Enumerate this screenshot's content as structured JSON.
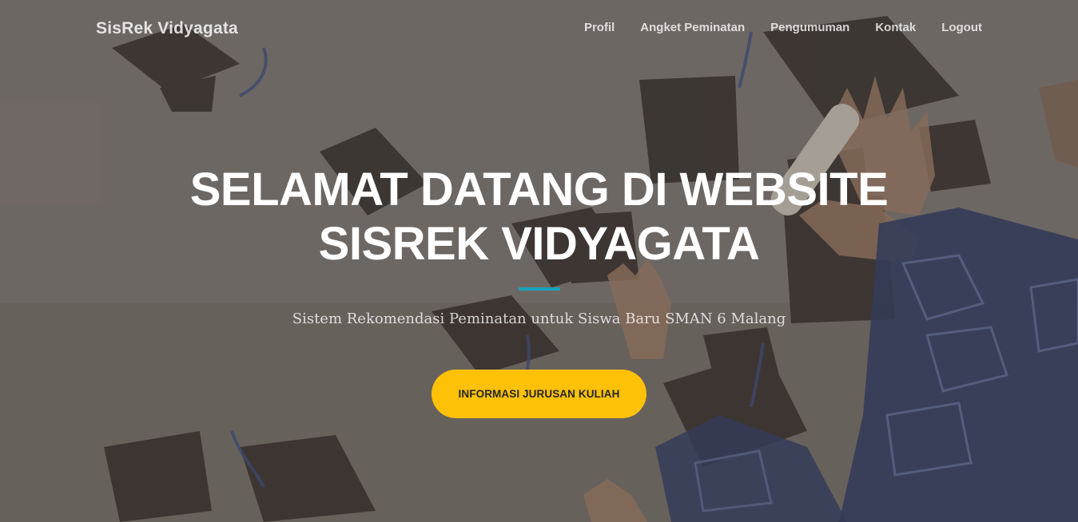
{
  "navbar": {
    "brand": "SisRek Vidyagata",
    "links": [
      {
        "label": "Profil"
      },
      {
        "label": "Angket Peminatan"
      },
      {
        "label": "Pengumuman"
      },
      {
        "label": "Kontak"
      },
      {
        "label": "Logout"
      }
    ]
  },
  "hero": {
    "title_line1": "SELAMAT DATANG DI WEBSITE",
    "title_line2": "SISREK VIDYAGATA",
    "subtitle": "Sistem Rekomendasi Peminatan untuk Siswa Baru SMAN 6 Malang",
    "cta_label": "INFORMASI JURUSAN KULIAH",
    "background_image": "graduation-caps-thrown-in-air"
  },
  "colors": {
    "accent_divider": "#17a2b8",
    "cta_background": "#ffc107",
    "cta_text": "#212529",
    "text": "#ffffff"
  }
}
